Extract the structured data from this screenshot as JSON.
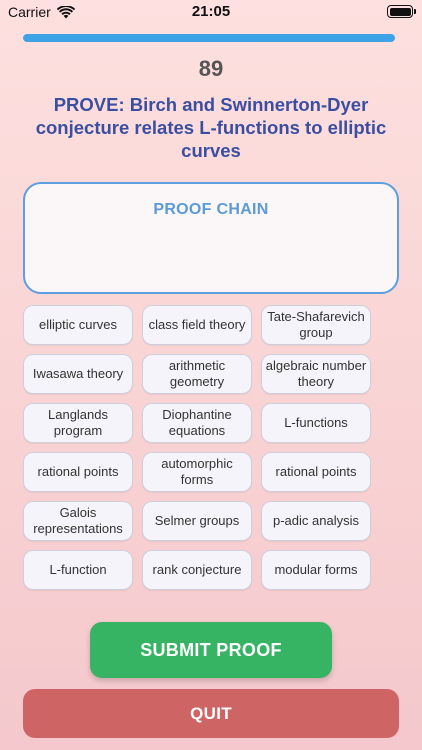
{
  "status_bar": {
    "carrier": "Carrier",
    "time": "21:05",
    "icons": [
      "wifi-icon",
      "battery-icon"
    ]
  },
  "progress": {
    "fraction": 1.0,
    "fill_color": "#3ea3e6"
  },
  "score": "89",
  "question": "PROVE: Birch and Swinnerton-Dyer conjecture relates L-functions to elliptic curves",
  "proof_chain": {
    "title": "PROOF CHAIN"
  },
  "terms": [
    "elliptic curves",
    "class field theory",
    "Tate-Shafarevich group",
    "Iwasawa theory",
    "arithmetic geometry",
    "algebraic number theory",
    "Langlands program",
    "Diophantine equations",
    "L-functions",
    "rational points",
    "automorphic forms",
    "rational points",
    "Galois representations",
    "Selmer groups",
    "p-adic analysis",
    "L-function",
    "rank conjecture",
    "modular forms"
  ],
  "buttons": {
    "submit": "SUBMIT PROOF",
    "quit": "QUIT"
  },
  "colors": {
    "question": "#3b4fa1",
    "proof_chain_border": "#5b9fe0",
    "submit": "#36b463",
    "quit": "#cf6464"
  }
}
